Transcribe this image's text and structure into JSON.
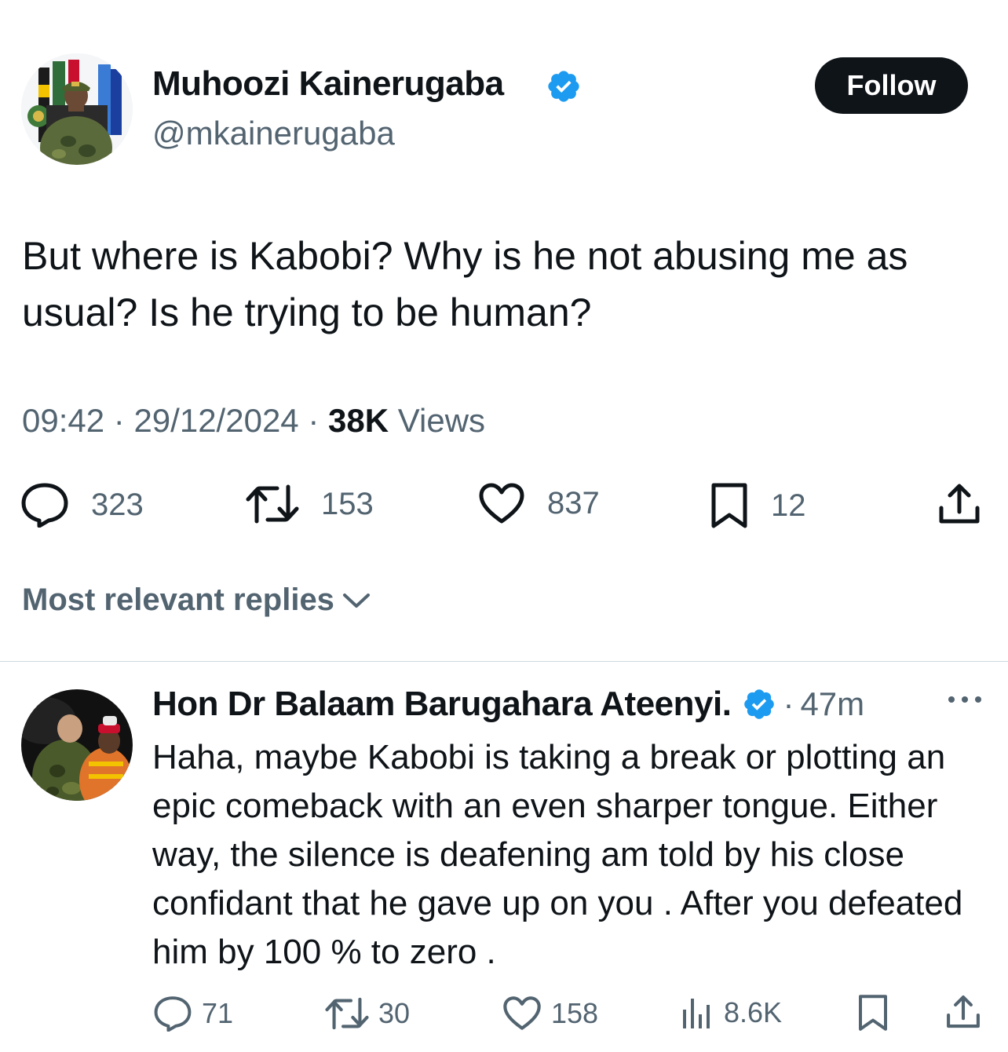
{
  "tweet": {
    "author_name": "Muhoozi Kainerugaba",
    "author_handle": "@mkainerugaba",
    "follow_label": "Follow",
    "text": "But where is Kabobi? Why is he not abusing me as usual? Is he trying to be human?",
    "time": "09:42",
    "date": "29/12/2024",
    "separator": "·",
    "views_count": "38K",
    "views_label": "Views",
    "stats": {
      "replies": "323",
      "retweets": "153",
      "likes": "837",
      "bookmarks": "12"
    }
  },
  "replies_sort": {
    "label": "Most relevant replies"
  },
  "reply": {
    "author_name": "Hon Dr Balaam Barugahara Ateenyi.",
    "separator": "·",
    "time": "47m",
    "text": "Haha, maybe Kabobi is taking a break or plotting an epic comeback with an even sharper tongue. Either way, the silence is deafening am told by his close confidant that he gave up on you . After you defeated him by 100 % to zero .",
    "stats": {
      "replies": "71",
      "retweets": "30",
      "likes": "158",
      "views": "8.6K"
    }
  },
  "colors": {
    "verified_blue": "#1d9bf0",
    "text_primary": "#0f1419",
    "text_secondary": "#536471",
    "follow_bg": "#0f1419",
    "divider": "#cfd9de"
  },
  "icons": {
    "reply": "speech-bubble-icon",
    "retweet": "retweet-icon",
    "like": "heart-icon",
    "bookmark": "bookmark-icon",
    "share": "share-icon",
    "views": "bar-chart-icon",
    "more": "more-dots-icon",
    "verified": "verified-badge-icon",
    "chevron": "chevron-down-icon"
  }
}
